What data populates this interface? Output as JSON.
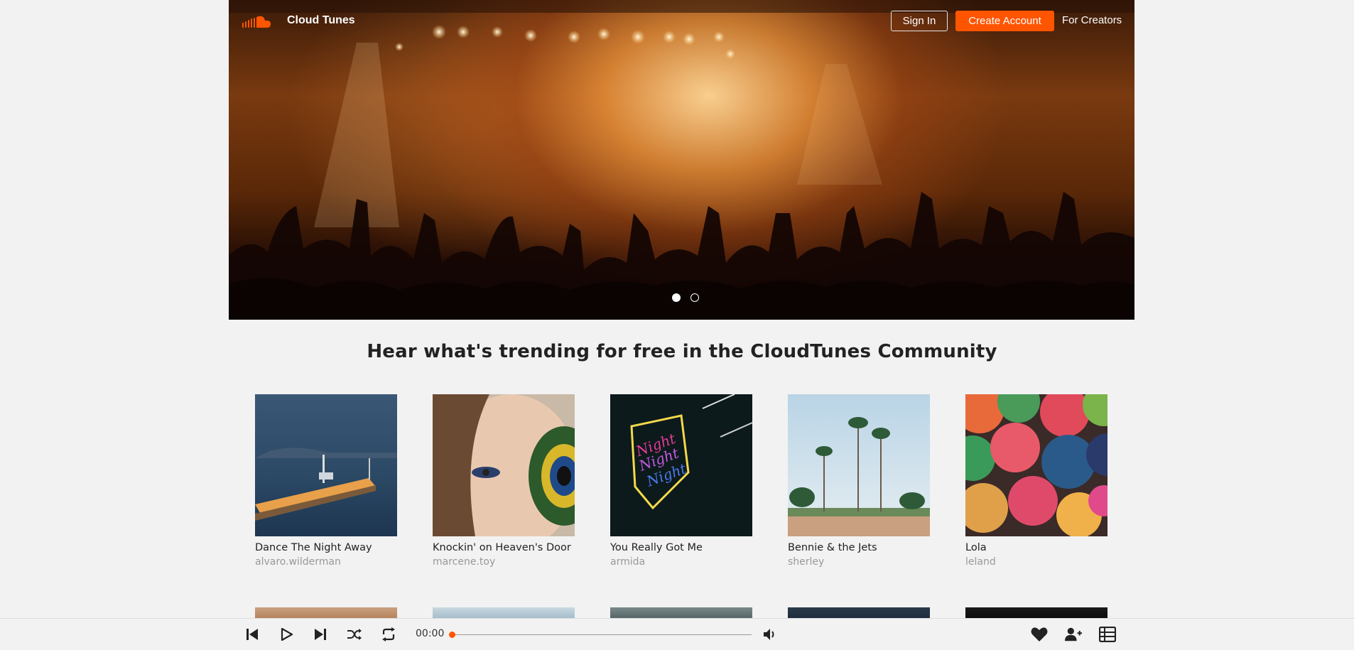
{
  "header": {
    "brand": "Cloud Tunes",
    "sign_in": "Sign In",
    "create_account": "Create Account",
    "for_creators": "For Creators",
    "logo_icon": "soundcloud-logo-icon",
    "accent_color": "#ff5500"
  },
  "hero": {
    "image": "concert crowd with raised hands under orange stage lights",
    "slides_total": 2,
    "active_slide": 1
  },
  "main": {
    "heading": "Hear what's trending for free in the CloudTunes Community",
    "tracks": [
      {
        "title": "Dance The Night Away",
        "artist": "alvaro.wilderman"
      },
      {
        "title": "Knockin' on Heaven's Door",
        "artist": "marcene.toy"
      },
      {
        "title": "You Really Got Me",
        "artist": "armida"
      },
      {
        "title": "Bennie & the Jets",
        "artist": "sherley"
      },
      {
        "title": "Lola",
        "artist": "leland"
      }
    ]
  },
  "player": {
    "time": "00:00",
    "progress": 0,
    "icons": [
      "skip-back-icon",
      "play-icon",
      "skip-forward-icon",
      "shuffle-icon",
      "repeat-icon",
      "volume-icon",
      "heart-icon",
      "add-user-icon",
      "queue-list-icon"
    ]
  }
}
